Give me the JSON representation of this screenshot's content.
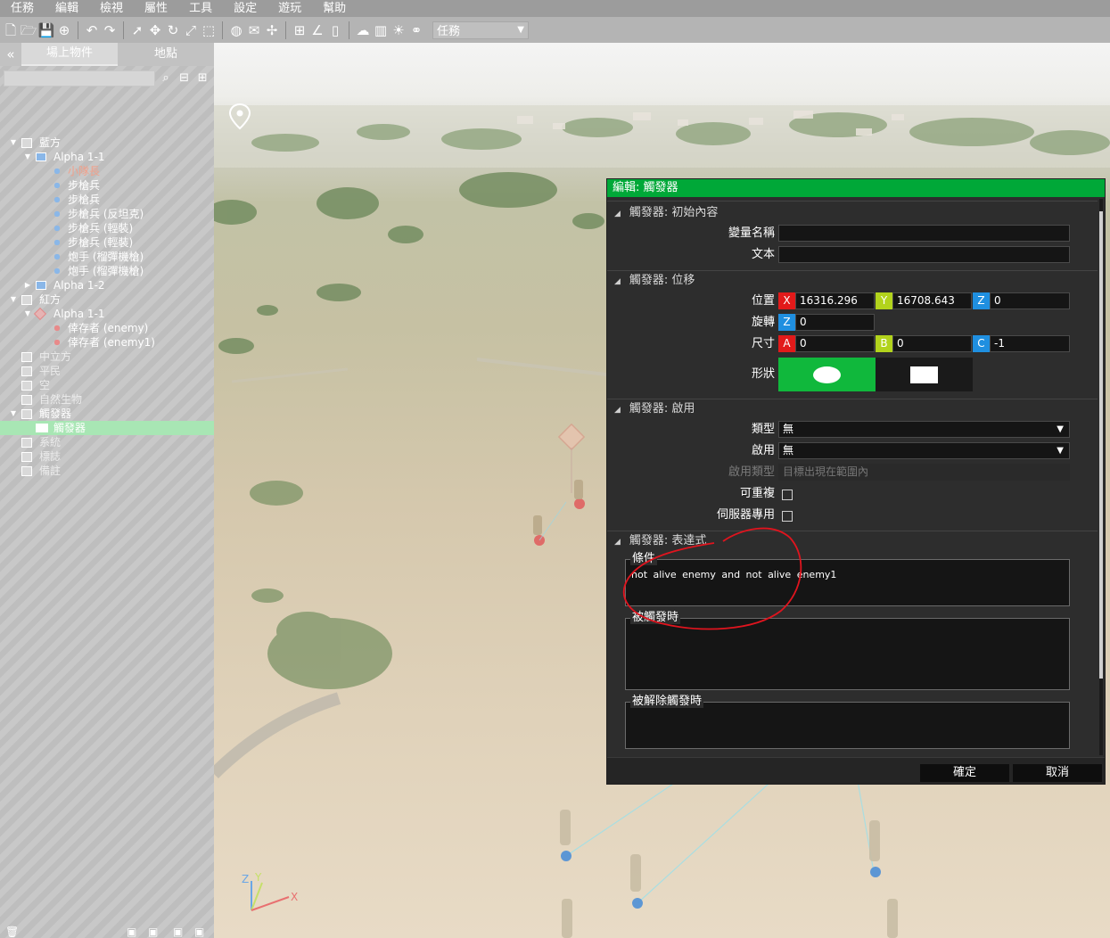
{
  "menu": [
    "任務",
    "編輯",
    "檢視",
    "屬性",
    "工具",
    "設定",
    "遊玩",
    "幫助"
  ],
  "toolbar": {
    "mode_select": "任務"
  },
  "sidebar": {
    "collapse_glyph": "«",
    "tabs": [
      "場上物件",
      "地點"
    ],
    "tree": [
      {
        "label": "藍方",
        "level": 0,
        "arrow": "▼",
        "checkbox": true
      },
      {
        "label": "Alpha 1-1",
        "level": 1,
        "arrow": "▼",
        "icon": "group-blue"
      },
      {
        "label": "小隊長",
        "level": 2,
        "icon": "unit-blue",
        "highlight": true
      },
      {
        "label": "步槍兵",
        "level": 2,
        "icon": "unit-blue"
      },
      {
        "label": "步槍兵",
        "level": 2,
        "icon": "unit-blue"
      },
      {
        "label": "步槍兵 (反坦克)",
        "level": 2,
        "icon": "unit-blue"
      },
      {
        "label": "步槍兵 (輕裝)",
        "level": 2,
        "icon": "unit-blue"
      },
      {
        "label": "步槍兵 (輕裝)",
        "level": 2,
        "icon": "unit-blue"
      },
      {
        "label": "炮手 (榴彈機槍)",
        "level": 2,
        "icon": "unit-blue"
      },
      {
        "label": "炮手 (榴彈機槍)",
        "level": 2,
        "icon": "unit-blue"
      },
      {
        "label": "Alpha 1-2",
        "level": 1,
        "arrow": "▶",
        "icon": "group-blue"
      },
      {
        "label": "紅方",
        "level": 0,
        "arrow": "▼",
        "checkbox": true
      },
      {
        "label": "Alpha 1-1",
        "level": 1,
        "arrow": "▼",
        "icon": "group-red"
      },
      {
        "label": "倖存者 (enemy)",
        "level": 2,
        "icon": "unit-red"
      },
      {
        "label": "倖存者 (enemy1)",
        "level": 2,
        "icon": "unit-red"
      },
      {
        "label": "中立方",
        "level": 0,
        "checkbox": true,
        "dim": true
      },
      {
        "label": "平民",
        "level": 0,
        "checkbox": true,
        "dim": true
      },
      {
        "label": "空",
        "level": 0,
        "checkbox": true,
        "dim": true
      },
      {
        "label": "自然生物",
        "level": 0,
        "checkbox": true,
        "dim": true
      },
      {
        "label": "觸發器",
        "level": 0,
        "arrow": "▼",
        "checkbox": true
      },
      {
        "label": "觸發器",
        "level": 1,
        "icon": "flag",
        "selected": true
      },
      {
        "label": "系統",
        "level": 0,
        "checkbox": true,
        "dim": true
      },
      {
        "label": "標誌",
        "level": 0,
        "checkbox": true,
        "dim": true
      },
      {
        "label": "備註",
        "level": 0,
        "checkbox": true,
        "dim": true
      }
    ]
  },
  "viewport": {
    "axes": {
      "z": "Z",
      "y": "Y",
      "x": "X"
    }
  },
  "dialog": {
    "title": "編輯: 觸發器",
    "sections": {
      "init": {
        "title": "觸發器: 初始內容",
        "var_label": "變量名稱",
        "var_value": "",
        "text_label": "文本",
        "text_value": ""
      },
      "transform": {
        "title": "觸發器: 位移",
        "pos_label": "位置",
        "pos_x_tag": "X",
        "pos_x": "16316.296",
        "pos_y_tag": "Y",
        "pos_y": "16708.643",
        "pos_z_tag": "Z",
        "pos_z": "0",
        "rot_label": "旋轉",
        "rot_z_tag": "Z",
        "rot_z": "0",
        "size_label": "尺寸",
        "size_a_tag": "A",
        "size_a": "0",
        "size_b_tag": "B",
        "size_b": "0",
        "size_c_tag": "C",
        "size_c": "-1",
        "shape_label": "形狀"
      },
      "activation": {
        "title": "觸發器: 啟用",
        "type_label": "類型",
        "type_value": "無",
        "act_label": "啟用",
        "act_value": "無",
        "acttype_label": "啟用類型",
        "acttype_value": "目標出現在範圍內",
        "repeat_label": "可重複",
        "server_label": "伺服器專用"
      },
      "expression": {
        "title": "觸發器: 表達式",
        "cond_label": "條件",
        "cond_value": "not alive enemy and not alive enemy1",
        "onact_label": "被觸發時",
        "onact_value": "",
        "ondeact_label": "被解除觸發時",
        "ondeact_value": ""
      }
    },
    "buttons": {
      "ok": "確定",
      "cancel": "取消"
    }
  },
  "colors": {
    "accent_green": "#00a838",
    "axis_x": "#e21a1a",
    "axis_y": "#b2d31c",
    "axis_z": "#1f8fe0",
    "annotation": "#e0141e"
  }
}
